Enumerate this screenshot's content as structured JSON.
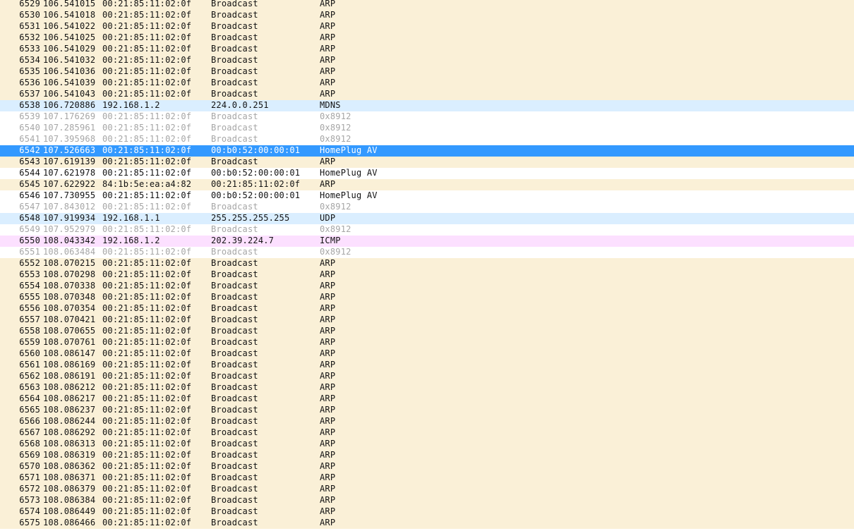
{
  "packets": [
    {
      "no": "6529",
      "time": "106.541015",
      "src": "00:21:85:11:02:0f",
      "dst": "Broadcast",
      "proto": "ARP",
      "style": "arp"
    },
    {
      "no": "6530",
      "time": "106.541018",
      "src": "00:21:85:11:02:0f",
      "dst": "Broadcast",
      "proto": "ARP",
      "style": "arp"
    },
    {
      "no": "6531",
      "time": "106.541022",
      "src": "00:21:85:11:02:0f",
      "dst": "Broadcast",
      "proto": "ARP",
      "style": "arp"
    },
    {
      "no": "6532",
      "time": "106.541025",
      "src": "00:21:85:11:02:0f",
      "dst": "Broadcast",
      "proto": "ARP",
      "style": "arp"
    },
    {
      "no": "6533",
      "time": "106.541029",
      "src": "00:21:85:11:02:0f",
      "dst": "Broadcast",
      "proto": "ARP",
      "style": "arp"
    },
    {
      "no": "6534",
      "time": "106.541032",
      "src": "00:21:85:11:02:0f",
      "dst": "Broadcast",
      "proto": "ARP",
      "style": "arp"
    },
    {
      "no": "6535",
      "time": "106.541036",
      "src": "00:21:85:11:02:0f",
      "dst": "Broadcast",
      "proto": "ARP",
      "style": "arp"
    },
    {
      "no": "6536",
      "time": "106.541039",
      "src": "00:21:85:11:02:0f",
      "dst": "Broadcast",
      "proto": "ARP",
      "style": "arp"
    },
    {
      "no": "6537",
      "time": "106.541043",
      "src": "00:21:85:11:02:0f",
      "dst": "Broadcast",
      "proto": "ARP",
      "style": "arp"
    },
    {
      "no": "6538",
      "time": "106.720886",
      "src": "192.168.1.2",
      "dst": "224.0.0.251",
      "proto": "MDNS",
      "style": "mdns"
    },
    {
      "no": "6539",
      "time": "107.176269",
      "src": "00:21:85:11:02:0f",
      "dst": "Broadcast",
      "proto": "0x8912",
      "style": "dim"
    },
    {
      "no": "6540",
      "time": "107.285961",
      "src": "00:21:85:11:02:0f",
      "dst": "Broadcast",
      "proto": "0x8912",
      "style": "dim"
    },
    {
      "no": "6541",
      "time": "107.395968",
      "src": "00:21:85:11:02:0f",
      "dst": "Broadcast",
      "proto": "0x8912",
      "style": "dim"
    },
    {
      "no": "6542",
      "time": "107.526663",
      "src": "00:21:85:11:02:0f",
      "dst": "00:b0:52:00:00:01",
      "proto": "HomePlug AV",
      "style": "selected"
    },
    {
      "no": "6543",
      "time": "107.619139",
      "src": "00:21:85:11:02:0f",
      "dst": "Broadcast",
      "proto": "ARP",
      "style": "arp"
    },
    {
      "no": "6544",
      "time": "107.621978",
      "src": "00:21:85:11:02:0f",
      "dst": "00:b0:52:00:00:01",
      "proto": "HomePlug AV",
      "style": "plain"
    },
    {
      "no": "6545",
      "time": "107.622922",
      "src": "84:1b:5e:ea:a4:82",
      "dst": "00:21:85:11:02:0f",
      "proto": "ARP",
      "style": "arp"
    },
    {
      "no": "6546",
      "time": "107.730955",
      "src": "00:21:85:11:02:0f",
      "dst": "00:b0:52:00:00:01",
      "proto": "HomePlug AV",
      "style": "plain"
    },
    {
      "no": "6547",
      "time": "107.843012",
      "src": "00:21:85:11:02:0f",
      "dst": "Broadcast",
      "proto": "0x8912",
      "style": "dim"
    },
    {
      "no": "6548",
      "time": "107.919934",
      "src": "192.168.1.1",
      "dst": "255.255.255.255",
      "proto": "UDP",
      "style": "udp"
    },
    {
      "no": "6549",
      "time": "107.952979",
      "src": "00:21:85:11:02:0f",
      "dst": "Broadcast",
      "proto": "0x8912",
      "style": "dim"
    },
    {
      "no": "6550",
      "time": "108.043342",
      "src": "192.168.1.2",
      "dst": "202.39.224.7",
      "proto": "ICMP",
      "style": "icmp"
    },
    {
      "no": "6551",
      "time": "108.063484",
      "src": "00:21:85:11:02:0f",
      "dst": "Broadcast",
      "proto": "0x8912",
      "style": "dim"
    },
    {
      "no": "6552",
      "time": "108.070215",
      "src": "00:21:85:11:02:0f",
      "dst": "Broadcast",
      "proto": "ARP",
      "style": "arp"
    },
    {
      "no": "6553",
      "time": "108.070298",
      "src": "00:21:85:11:02:0f",
      "dst": "Broadcast",
      "proto": "ARP",
      "style": "arp"
    },
    {
      "no": "6554",
      "time": "108.070338",
      "src": "00:21:85:11:02:0f",
      "dst": "Broadcast",
      "proto": "ARP",
      "style": "arp"
    },
    {
      "no": "6555",
      "time": "108.070348",
      "src": "00:21:85:11:02:0f",
      "dst": "Broadcast",
      "proto": "ARP",
      "style": "arp"
    },
    {
      "no": "6556",
      "time": "108.070354",
      "src": "00:21:85:11:02:0f",
      "dst": "Broadcast",
      "proto": "ARP",
      "style": "arp"
    },
    {
      "no": "6557",
      "time": "108.070421",
      "src": "00:21:85:11:02:0f",
      "dst": "Broadcast",
      "proto": "ARP",
      "style": "arp"
    },
    {
      "no": "6558",
      "time": "108.070655",
      "src": "00:21:85:11:02:0f",
      "dst": "Broadcast",
      "proto": "ARP",
      "style": "arp"
    },
    {
      "no": "6559",
      "time": "108.070761",
      "src": "00:21:85:11:02:0f",
      "dst": "Broadcast",
      "proto": "ARP",
      "style": "arp"
    },
    {
      "no": "6560",
      "time": "108.086147",
      "src": "00:21:85:11:02:0f",
      "dst": "Broadcast",
      "proto": "ARP",
      "style": "arp"
    },
    {
      "no": "6561",
      "time": "108.086169",
      "src": "00:21:85:11:02:0f",
      "dst": "Broadcast",
      "proto": "ARP",
      "style": "arp"
    },
    {
      "no": "6562",
      "time": "108.086191",
      "src": "00:21:85:11:02:0f",
      "dst": "Broadcast",
      "proto": "ARP",
      "style": "arp"
    },
    {
      "no": "6563",
      "time": "108.086212",
      "src": "00:21:85:11:02:0f",
      "dst": "Broadcast",
      "proto": "ARP",
      "style": "arp"
    },
    {
      "no": "6564",
      "time": "108.086217",
      "src": "00:21:85:11:02:0f",
      "dst": "Broadcast",
      "proto": "ARP",
      "style": "arp"
    },
    {
      "no": "6565",
      "time": "108.086237",
      "src": "00:21:85:11:02:0f",
      "dst": "Broadcast",
      "proto": "ARP",
      "style": "arp"
    },
    {
      "no": "6566",
      "time": "108.086244",
      "src": "00:21:85:11:02:0f",
      "dst": "Broadcast",
      "proto": "ARP",
      "style": "arp"
    },
    {
      "no": "6567",
      "time": "108.086292",
      "src": "00:21:85:11:02:0f",
      "dst": "Broadcast",
      "proto": "ARP",
      "style": "arp"
    },
    {
      "no": "6568",
      "time": "108.086313",
      "src": "00:21:85:11:02:0f",
      "dst": "Broadcast",
      "proto": "ARP",
      "style": "arp"
    },
    {
      "no": "6569",
      "time": "108.086319",
      "src": "00:21:85:11:02:0f",
      "dst": "Broadcast",
      "proto": "ARP",
      "style": "arp"
    },
    {
      "no": "6570",
      "time": "108.086362",
      "src": "00:21:85:11:02:0f",
      "dst": "Broadcast",
      "proto": "ARP",
      "style": "arp"
    },
    {
      "no": "6571",
      "time": "108.086371",
      "src": "00:21:85:11:02:0f",
      "dst": "Broadcast",
      "proto": "ARP",
      "style": "arp"
    },
    {
      "no": "6572",
      "time": "108.086379",
      "src": "00:21:85:11:02:0f",
      "dst": "Broadcast",
      "proto": "ARP",
      "style": "arp"
    },
    {
      "no": "6573",
      "time": "108.086384",
      "src": "00:21:85:11:02:0f",
      "dst": "Broadcast",
      "proto": "ARP",
      "style": "arp"
    },
    {
      "no": "6574",
      "time": "108.086449",
      "src": "00:21:85:11:02:0f",
      "dst": "Broadcast",
      "proto": "ARP",
      "style": "arp"
    },
    {
      "no": "6575",
      "time": "108.086466",
      "src": "00:21:85:11:02:0f",
      "dst": "Broadcast",
      "proto": "ARP",
      "style": "arp"
    }
  ]
}
